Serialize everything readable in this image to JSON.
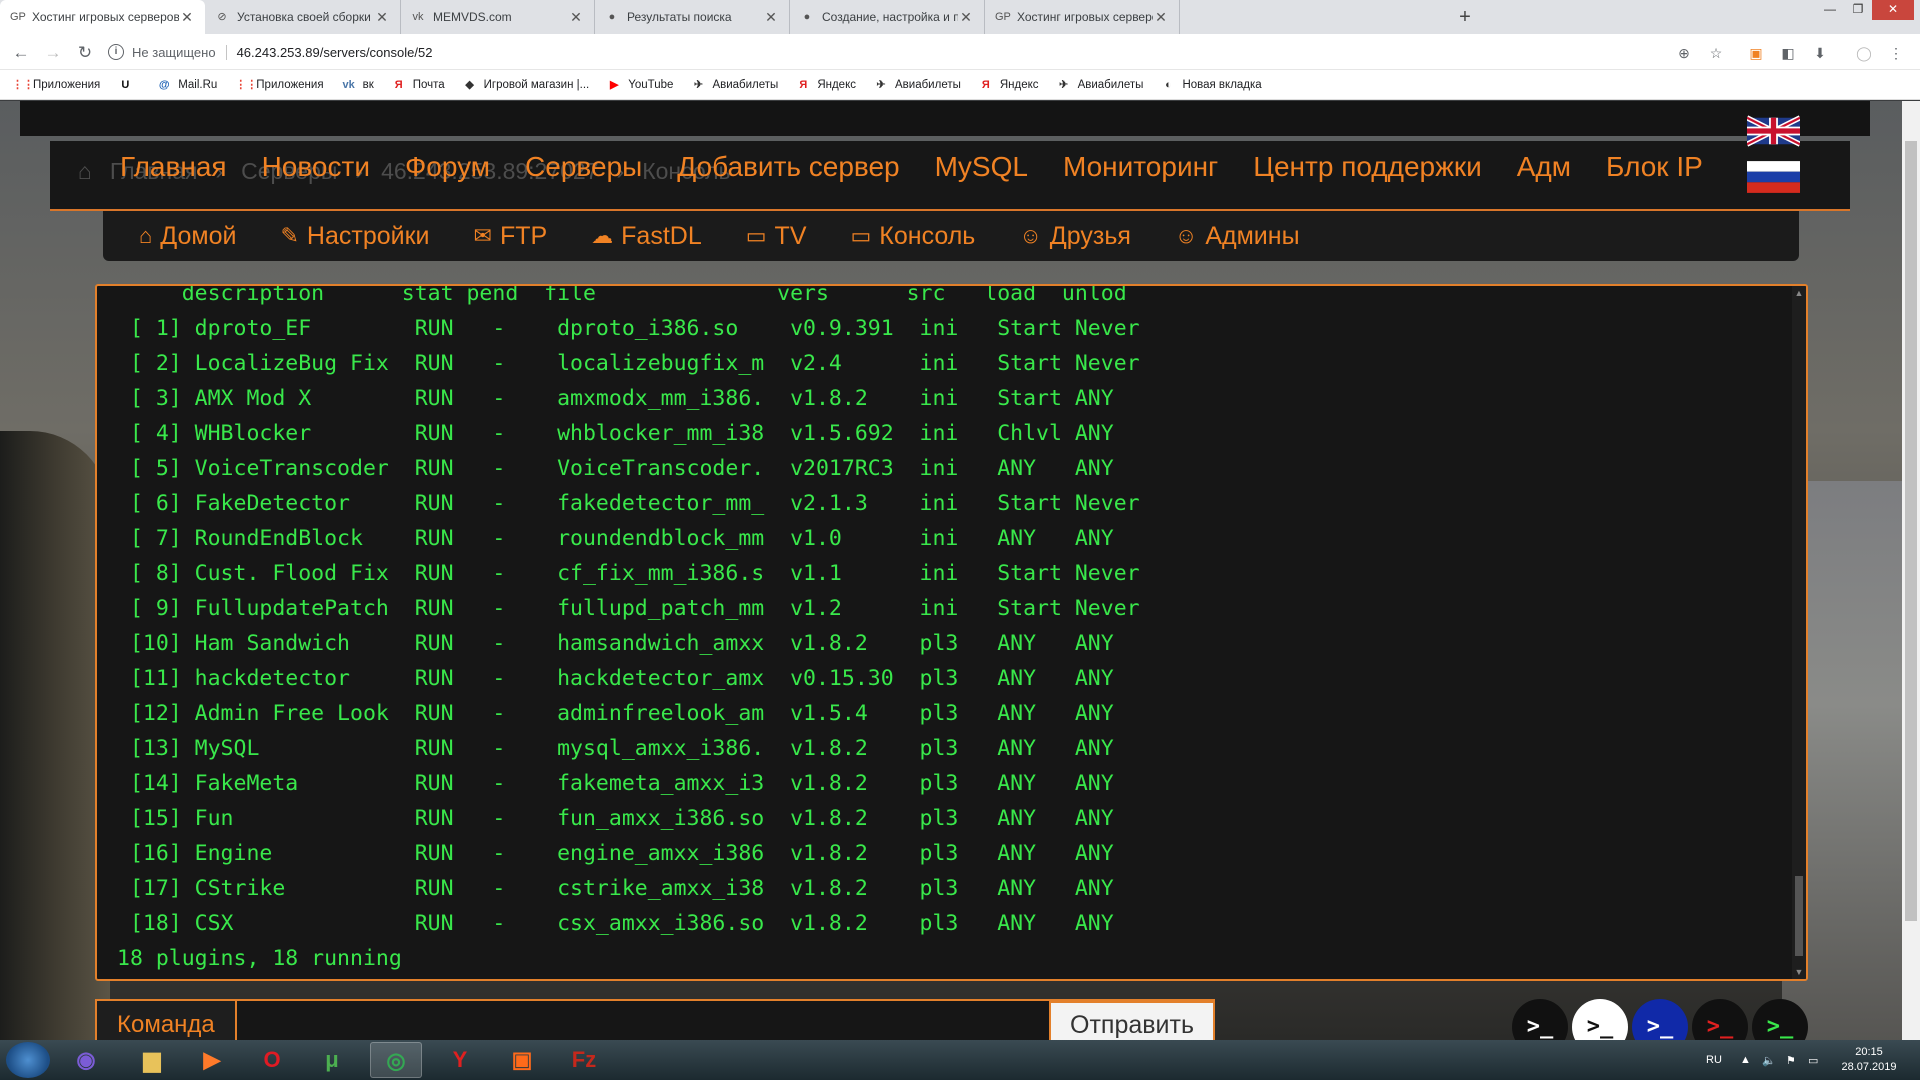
{
  "browser": {
    "tabs": [
      {
        "title": "Хостинг игровых серверов",
        "icon": "GP",
        "active": true
      },
      {
        "title": "Установка своей сборки Counte",
        "icon": "⊘",
        "active": false
      },
      {
        "title": "MEMVDS.com",
        "icon": "vk",
        "active": false
      },
      {
        "title": "Результаты поиска",
        "icon": "●",
        "active": false
      },
      {
        "title": "Создание, настройка и продви",
        "icon": "●",
        "active": false
      },
      {
        "title": "Хостинг игровых серверов",
        "icon": "GP",
        "active": false
      }
    ],
    "address": {
      "security": "Не защищено",
      "url": "46.243.253.89/servers/console/52"
    },
    "bookmarks": [
      {
        "label": "Приложения",
        "icon": "⋮⋮",
        "color": "#e84335"
      },
      {
        "label": "",
        "icon": "U",
        "color": "#111111"
      },
      {
        "label": "Mail.Ru",
        "icon": "@",
        "color": "#1a5fb4"
      },
      {
        "label": "Приложения",
        "icon": "⋮⋮",
        "color": "#e84335"
      },
      {
        "label": "вк",
        "icon": "vk",
        "color": "#4a76a8"
      },
      {
        "label": "Почта",
        "icon": "Я",
        "color": "#e02020"
      },
      {
        "label": "Игровой магазин |...",
        "icon": "◆",
        "color": "#333333"
      },
      {
        "label": "YouTube",
        "icon": "▶",
        "color": "#ff0000"
      },
      {
        "label": "Авиабилеты",
        "icon": "✈",
        "color": "#333333"
      },
      {
        "label": "Яндекс",
        "icon": "Я",
        "color": "#e02020"
      },
      {
        "label": "Авиабилеты",
        "icon": "✈",
        "color": "#333333"
      },
      {
        "label": "Яндекс",
        "icon": "Я",
        "color": "#e02020"
      },
      {
        "label": "Авиабилеты",
        "icon": "✈",
        "color": "#333333"
      },
      {
        "label": "Новая вкладка",
        "icon": "◐",
        "color": "#333333"
      }
    ]
  },
  "site": {
    "accent": "#f08224",
    "breadcrumb": [
      "Главная",
      "Серверы",
      "46.243.253.89:27027",
      "Консоль"
    ],
    "top_nav": [
      "Главная",
      "Новости",
      "Форум",
      "Серверы",
      "Добавить сервер",
      "MySQL",
      "Мониторинг",
      "Центр поддержки",
      "Адм",
      "Блок IP"
    ],
    "sub_nav": [
      {
        "label": "Домой",
        "icon": "⌂"
      },
      {
        "label": "Настройки",
        "icon": "✎"
      },
      {
        "label": "FTP",
        "icon": "✉"
      },
      {
        "label": "FastDL",
        "icon": "☁"
      },
      {
        "label": "TV",
        "icon": "▭"
      },
      {
        "label": "Консоль",
        "icon": "▭"
      },
      {
        "label": "Друзья",
        "icon": "☺"
      },
      {
        "label": "Админы",
        "icon": "☺"
      }
    ],
    "console_lines": [
      "     description      stat pend  file              vers      src   load  unlod",
      " [ 1] dproto_EF        RUN   -    dproto_i386.so    v0.9.391  ini   Start Never",
      " [ 2] LocalizeBug Fix  RUN   -    localizebugfix_m  v2.4      ini   Start Never",
      " [ 3] AMX Mod X        RUN   -    amxmodx_mm_i386.  v1.8.2    ini   Start ANY",
      " [ 4] WHBlocker        RUN   -    whblocker_mm_i38  v1.5.692  ini   Chlvl ANY",
      " [ 5] VoiceTranscoder  RUN   -    VoiceTranscoder.  v2017RC3  ini   ANY   ANY",
      " [ 6] FakeDetector     RUN   -    fakedetector_mm_  v2.1.3    ini   Start Never",
      " [ 7] RoundEndBlock    RUN   -    roundendblock_mm  v1.0      ini   ANY   ANY",
      " [ 8] Cust. Flood Fix  RUN   -    cf_fix_mm_i386.s  v1.1      ini   Start Never",
      " [ 9] FullupdatePatch  RUN   -    fullupd_patch_mm  v1.2      ini   Start Never",
      " [10] Ham Sandwich     RUN   -    hamsandwich_amxx  v1.8.2    pl3   ANY   ANY",
      " [11] hackdetector     RUN   -    hackdetector_amx  v0.15.30  pl3   ANY   ANY",
      " [12] Admin Free Look  RUN   -    adminfreelook_am  v1.5.4    pl3   ANY   ANY",
      " [13] MySQL            RUN   -    mysql_amxx_i386.  v1.8.2    pl3   ANY   ANY",
      " [14] FakeMeta         RUN   -    fakemeta_amxx_i3  v1.8.2    pl3   ANY   ANY",
      " [15] Fun              RUN   -    fun_amxx_i386.so  v1.8.2    pl3   ANY   ANY",
      " [16] Engine           RUN   -    engine_amxx_i386  v1.8.2    pl3   ANY   ANY",
      " [17] CStrike          RUN   -    cstrike_amxx_i38  v1.8.2    pl3   ANY   ANY",
      " [18] CSX              RUN   -    csx_amxx_i386.so  v1.8.2    pl3   ANY   ANY",
      "18 plugins, 18 running"
    ],
    "command": {
      "label": "Команда",
      "value": "",
      "send": "Отправить"
    },
    "quick_buttons": [
      {
        "bg": "#111111",
        "fg": "#ffffff"
      },
      {
        "bg": "#ffffff",
        "fg": "#111111"
      },
      {
        "bg": "#1029a8",
        "fg": "#ffffff"
      },
      {
        "bg": "#111111",
        "fg": "#e02020"
      },
      {
        "bg": "#111111",
        "fg": "#39e84b"
      }
    ],
    "console_color": "#39e84b"
  },
  "taskbar": {
    "apps": [
      {
        "name": "viber",
        "glyph": "◉",
        "color": "#7b5cd6"
      },
      {
        "name": "explorer",
        "glyph": "▆",
        "color": "#e8c25a"
      },
      {
        "name": "media",
        "glyph": "▶",
        "color": "#ff7a2a"
      },
      {
        "name": "opera",
        "glyph": "O",
        "color": "#e01b24"
      },
      {
        "name": "torrent",
        "glyph": "μ",
        "color": "#4caf50"
      },
      {
        "name": "chrome",
        "glyph": "◎",
        "color": "#34a853"
      },
      {
        "name": "yandex",
        "glyph": "Y",
        "color": "#e02020"
      },
      {
        "name": "game",
        "glyph": "▣",
        "color": "#ff6a1a"
      },
      {
        "name": "filezilla",
        "glyph": "Fz",
        "color": "#c4281c"
      }
    ],
    "lang": "RU",
    "time": "20:15",
    "date": "28.07.2019"
  }
}
